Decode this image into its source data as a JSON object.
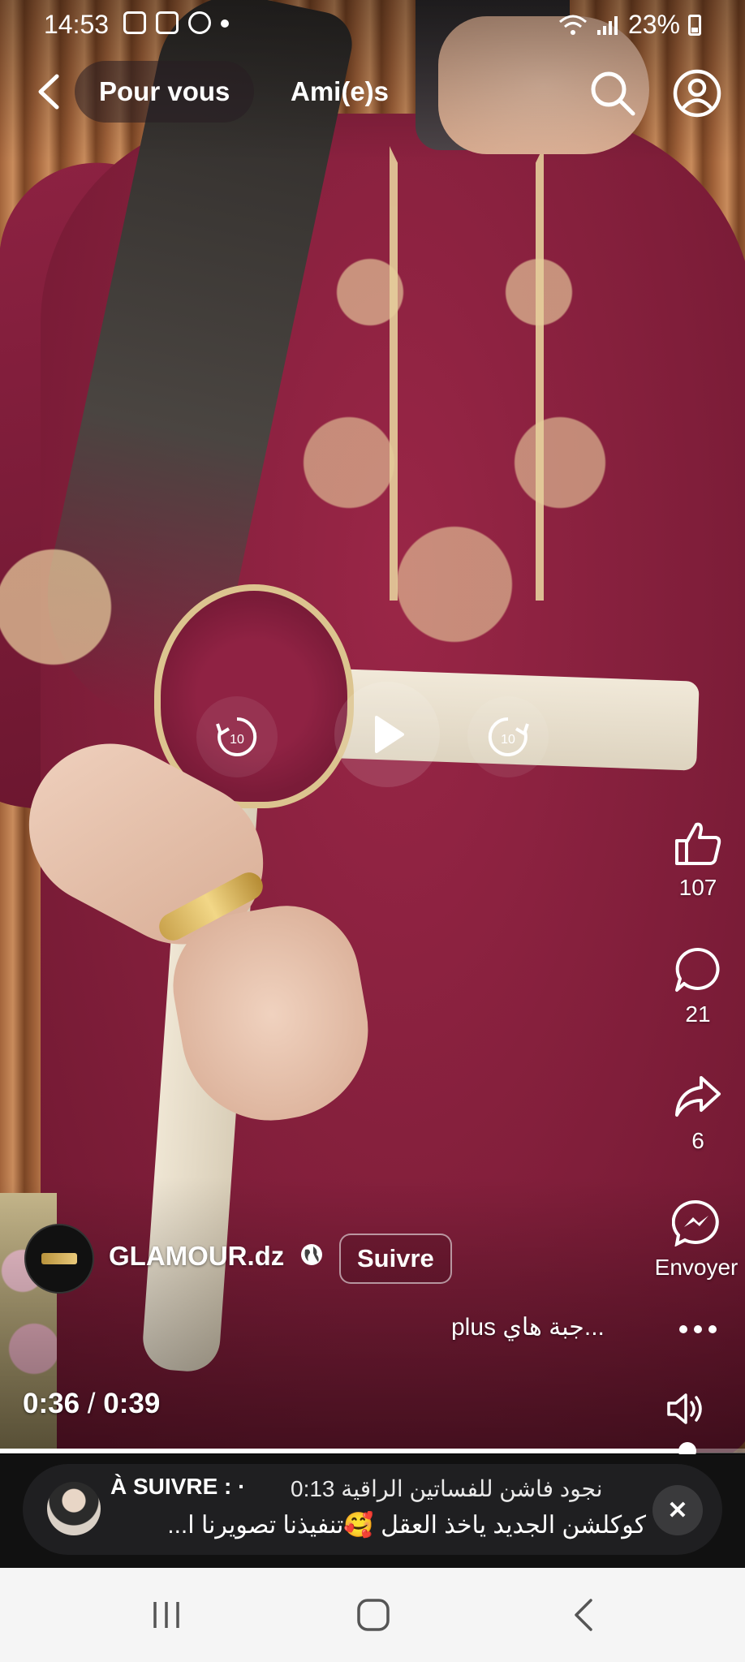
{
  "status_bar": {
    "time": "14:53",
    "notification_icons": [
      "gallery-icon",
      "instagram-icon",
      "messenger-icon"
    ],
    "battery": "23%"
  },
  "top_nav": {
    "tabs": [
      {
        "label": "Pour vous",
        "active": true
      },
      {
        "label": "Ami(e)s",
        "active": false
      }
    ],
    "icons": [
      "back-arrow-icon",
      "search-icon",
      "profile-icon"
    ]
  },
  "playback": {
    "rewind_seconds": "10",
    "forward_seconds": "10"
  },
  "actions": {
    "likes": "107",
    "comments": "21",
    "shares": "6",
    "send_label": "Envoyer"
  },
  "post": {
    "author": "GLAMOUR.dz",
    "follow_label": "Suivre",
    "caption": "جبة هاي...",
    "more_label": "plus",
    "elapsed": "0:36",
    "separator": "/",
    "duration": "0:39",
    "progress_fraction": 0.923
  },
  "next_up": {
    "label": "À SUIVRE : ·",
    "title": "0:13 نجود فاشن للفساتين الراقية",
    "description": "كوكلشن الجديد  ياخذ العقل 🥰تنفيذنا تصويرنا ا...",
    "close_label": "✕"
  },
  "colors": {
    "accent_white": "#ffffff",
    "dress": "#86203d",
    "nav_bar": "#f5f5f5"
  }
}
